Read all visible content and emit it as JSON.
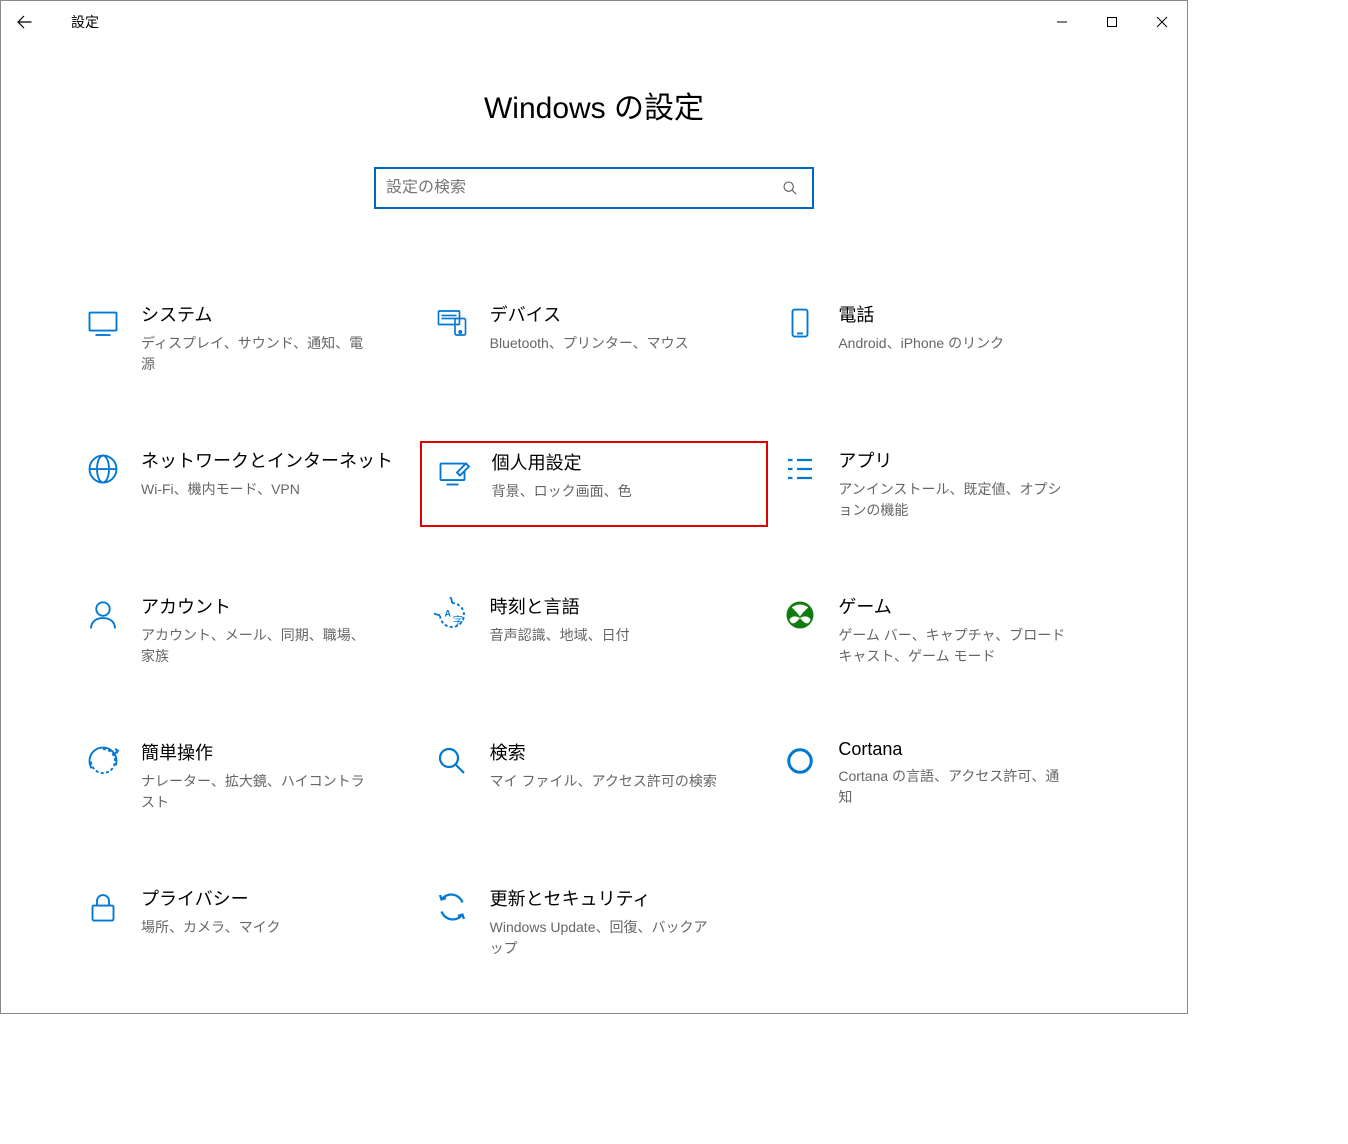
{
  "window": {
    "title": "設定",
    "back_icon": "back-icon",
    "min_icon": "minimize-icon",
    "max_icon": "maximize-icon",
    "close_icon": "close-icon"
  },
  "page": {
    "title": "Windows の設定"
  },
  "search": {
    "placeholder": "設定の検索",
    "icon": "search-icon"
  },
  "tiles": [
    {
      "id": "system",
      "title": "システム",
      "desc": "ディスプレイ、サウンド、通知、電源",
      "icon": "system-icon",
      "highlighted": false
    },
    {
      "id": "devices",
      "title": "デバイス",
      "desc": "Bluetooth、プリンター、マウス",
      "icon": "devices-icon",
      "highlighted": false
    },
    {
      "id": "phone",
      "title": "電話",
      "desc": "Android、iPhone のリンク",
      "icon": "phone-icon",
      "highlighted": false
    },
    {
      "id": "network",
      "title": "ネットワークとインターネット",
      "desc": "Wi-Fi、機内モード、VPN",
      "icon": "network-icon",
      "highlighted": false
    },
    {
      "id": "personalization",
      "title": "個人用設定",
      "desc": "背景、ロック画面、色",
      "icon": "personalization-icon",
      "highlighted": true
    },
    {
      "id": "apps",
      "title": "アプリ",
      "desc": "アンインストール、既定値、オプションの機能",
      "icon": "apps-icon",
      "highlighted": false
    },
    {
      "id": "accounts",
      "title": "アカウント",
      "desc": "アカウント、メール、同期、職場、家族",
      "icon": "accounts-icon",
      "highlighted": false
    },
    {
      "id": "time",
      "title": "時刻と言語",
      "desc": "音声認識、地域、日付",
      "icon": "time-icon",
      "highlighted": false
    },
    {
      "id": "gaming",
      "title": "ゲーム",
      "desc": "ゲーム バー、キャプチャ、ブロードキャスト、ゲーム モード",
      "icon": "gaming-icon",
      "highlighted": false
    },
    {
      "id": "ease",
      "title": "簡単操作",
      "desc": "ナレーター、拡大鏡、ハイコントラスト",
      "icon": "ease-icon",
      "highlighted": false
    },
    {
      "id": "search",
      "title": "検索",
      "desc": "マイ ファイル、アクセス許可の検索",
      "icon": "search-page-icon",
      "highlighted": false
    },
    {
      "id": "cortana",
      "title": "Cortana",
      "desc": "Cortana の言語、アクセス許可、通知",
      "icon": "cortana-icon",
      "highlighted": false
    },
    {
      "id": "privacy",
      "title": "プライバシー",
      "desc": "場所、カメラ、マイク",
      "icon": "privacy-icon",
      "highlighted": false
    },
    {
      "id": "update",
      "title": "更新とセキュリティ",
      "desc": "Windows Update、回復、バックアップ",
      "icon": "update-icon",
      "highlighted": false
    }
  ],
  "colors": {
    "accent": "#0078d4",
    "highlight": "#e00000"
  }
}
